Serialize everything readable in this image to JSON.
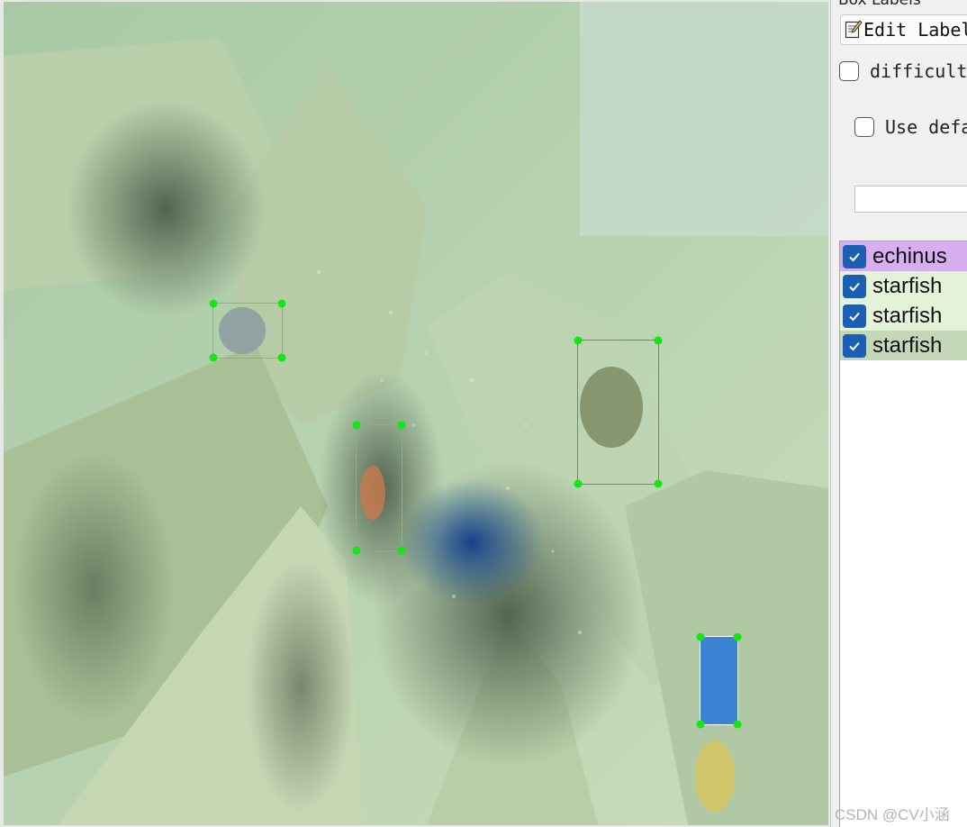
{
  "panel": {
    "title": "Box Labels",
    "edit_label_button": "Edit Label",
    "difficult_label": "difficult",
    "use_default_label": "Use default label",
    "default_label_value": ""
  },
  "labels": [
    {
      "name": "echinus",
      "checked": true,
      "color": "#d7aef0"
    },
    {
      "name": "starfish",
      "checked": true,
      "color": "#e3f3d8"
    },
    {
      "name": "starfish",
      "checked": true,
      "color": "#e3f3d8"
    },
    {
      "name": "starfish",
      "checked": true,
      "color": "#c4d8b9"
    }
  ],
  "colors": {
    "accent": "#1a5fb4",
    "handle": "#14e614",
    "box_stroke": "#7a70c8",
    "selected_box_fill": "#2a7ad8"
  },
  "watermark": "CSDN @CV小涵"
}
